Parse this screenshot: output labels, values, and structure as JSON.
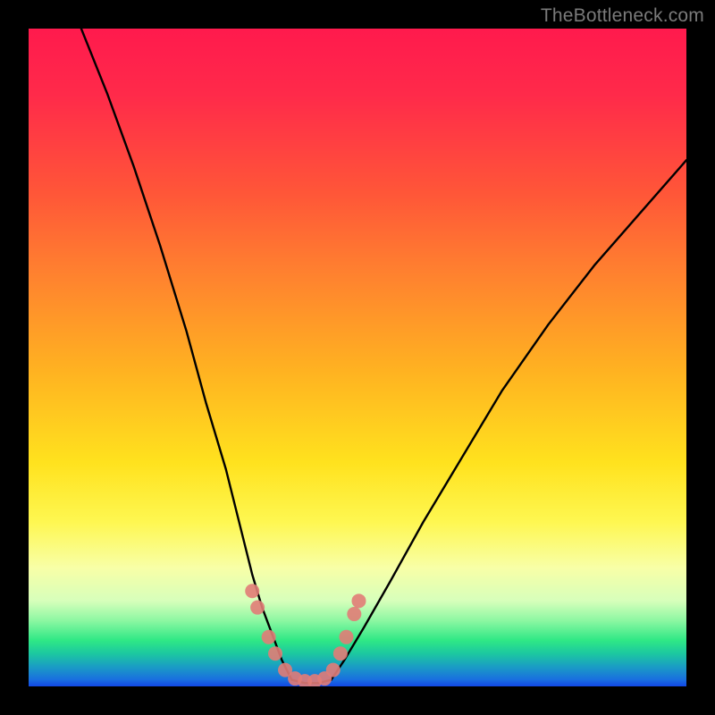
{
  "watermark": "TheBottleneck.com",
  "chart_data": {
    "type": "line",
    "title": "",
    "xlabel": "",
    "ylabel": "",
    "xlim": [
      0,
      100
    ],
    "ylim": [
      0,
      100
    ],
    "series": [
      {
        "name": "left-curve",
        "x": [
          8,
          12,
          16,
          20,
          24,
          27,
          30,
          32,
          34,
          35.5,
          37,
          38.5,
          40
        ],
        "y": [
          100,
          90,
          79,
          67,
          54,
          43,
          33,
          25,
          17,
          12,
          8,
          4,
          1
        ]
      },
      {
        "name": "right-curve",
        "x": [
          46,
          48,
          51,
          55,
          60,
          66,
          72,
          79,
          86,
          93,
          100
        ],
        "y": [
          1,
          4,
          9,
          16,
          25,
          35,
          45,
          55,
          64,
          72,
          80
        ]
      },
      {
        "name": "bottom-flat",
        "x": [
          40,
          42,
          44,
          46
        ],
        "y": [
          1,
          0.5,
          0.5,
          1
        ]
      }
    ],
    "markers": {
      "name": "salmon-dots",
      "color": "#e17c77",
      "points": [
        {
          "x": 34.0,
          "y": 14.5
        },
        {
          "x": 34.8,
          "y": 12.0
        },
        {
          "x": 36.5,
          "y": 7.5
        },
        {
          "x": 37.5,
          "y": 5.0
        },
        {
          "x": 39.0,
          "y": 2.5
        },
        {
          "x": 40.5,
          "y": 1.2
        },
        {
          "x": 42.0,
          "y": 0.8
        },
        {
          "x": 43.5,
          "y": 0.8
        },
        {
          "x": 45.0,
          "y": 1.2
        },
        {
          "x": 46.3,
          "y": 2.5
        },
        {
          "x": 47.4,
          "y": 5.0
        },
        {
          "x": 48.3,
          "y": 7.5
        },
        {
          "x": 49.5,
          "y": 11.0
        },
        {
          "x": 50.2,
          "y": 13.0
        }
      ]
    }
  }
}
